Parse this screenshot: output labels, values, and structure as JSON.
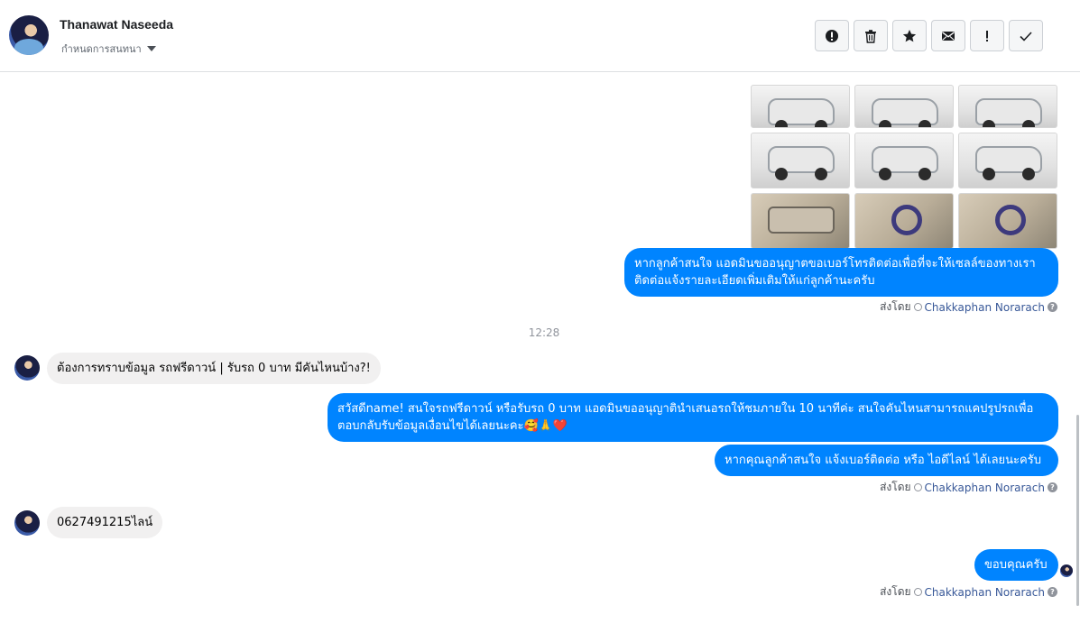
{
  "header": {
    "contact_name": "Thanawat Naseeda",
    "assign_label": "กำหนดการสนทนา",
    "toolbar": [
      {
        "name": "mark-spam-button",
        "icon": "alert-circle-icon"
      },
      {
        "name": "delete-button",
        "icon": "trash-icon"
      },
      {
        "name": "star-button",
        "icon": "star-icon"
      },
      {
        "name": "mark-unread-button",
        "icon": "envelope-icon"
      },
      {
        "name": "follow-up-button",
        "icon": "exclamation-icon"
      },
      {
        "name": "mark-done-button",
        "icon": "checkmark-icon"
      }
    ]
  },
  "thread": {
    "photos": {
      "rows": 3,
      "columns": 3,
      "kinds": [
        "exterior",
        "exterior",
        "exterior",
        "exterior",
        "exterior",
        "exterior",
        "interior",
        "interior",
        "interior"
      ]
    },
    "msg_out_1": "หากลูกค้าสนใจ แอดมินขออนุญาตขอเบอร์โทรติดต่อเพื่อที่จะให้เซลล์ของทางเราติดต่อแจ้งรายละเอียดเพิ่มเติมให้แก่ลูกค้านะครับ",
    "sent_by_prefix": "ส่งโดย",
    "agent_name": "Chakkaphan Norarach",
    "timestamp": "12:28",
    "msg_in_1": "ต้องการทราบข้อมูล รถฟรีดาวน์ | รับรถ 0 บาท มีคันไหนบ้าง?!",
    "msg_out_2": "สวัสดีname! สนใจรถฟรีดาวน์ หรือรับรถ 0 บาท แอดมินขออนุญาตินำเสนอรถให้ชมภายใน 10 นาทีค่ะ สนใจคันไหนสามารถแคปรูปรถเพื่อตอบกลับรับข้อมูลเงื่อนไขได้เลยนะคะ🥰🙏❤️",
    "msg_out_3": "หากคุณลูกค้าสนใจ แจ้งเบอร์ติดต่อ หรือ ไอดีไลน์ ได้เลยนะครับ",
    "msg_in_2": "0627491215ไลน์",
    "msg_out_4": "ขอบคุณครับ"
  }
}
